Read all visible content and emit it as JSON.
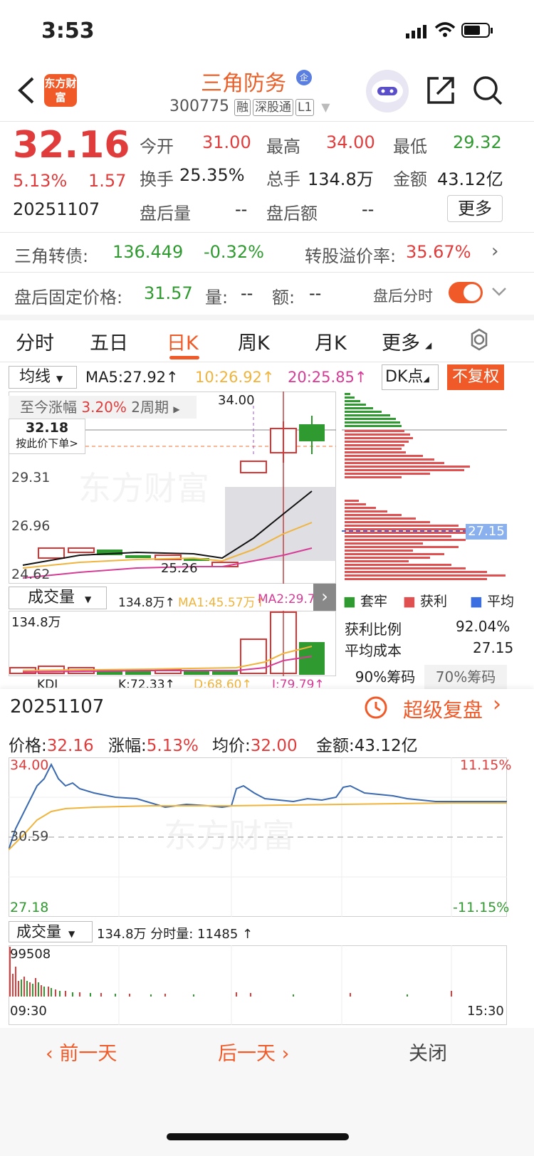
{
  "status": {
    "time": "3:53"
  },
  "header": {
    "name": "三角防务",
    "code": "300775",
    "tags": [
      "融",
      "深股通",
      "L1"
    ],
    "logo": "东方财富",
    "badge": "企"
  },
  "quote": {
    "price": "32.16",
    "pct": "5.13%",
    "chg": "1.57",
    "date": "20251107",
    "open_l": "今开",
    "open": "31.00",
    "high_l": "最高",
    "high": "34.00",
    "low_l": "最低",
    "low": "29.32",
    "turn_l": "换手",
    "turn": "25.35%",
    "vol_l": "总手",
    "vol": "134.8万",
    "amt_l": "金额",
    "amt": "43.12亿",
    "ah_vol_l": "盘后量",
    "ah_vol": "--",
    "ah_amt_l": "盘后额",
    "ah_amt": "--",
    "more": "更多"
  },
  "bond": {
    "label": "三角转债:",
    "price": "136.449",
    "pct": "-0.32%",
    "prem_l": "转股溢价率:",
    "prem": "35.67%"
  },
  "afterhours": {
    "label": "盘后固定价格:",
    "price": "31.57",
    "vol_l": "量:",
    "vol": "--",
    "amt_l": "额:",
    "amt": "--",
    "toggle_l": "盘后分时"
  },
  "tabs": [
    "分时",
    "五日",
    "日K",
    "周K",
    "月K",
    "更多"
  ],
  "kline": {
    "ma_select": "均线",
    "ma5": "MA5:27.92↑",
    "ma10": "10:26.92↑",
    "ma20": "20:25.85↑",
    "dk": "DK点",
    "fq": "不复权",
    "since_l": "至今涨幅",
    "since": "3.20%",
    "period": "2周期",
    "cursor_price": "32.18",
    "cursor_hint": "按此价下单>",
    "y1": "29.31",
    "y2": "26.96",
    "y3": "24.62",
    "hi": "34.00",
    "lo": "25.26",
    "chip_avg": "27.15",
    "vol_select": "成交量",
    "vol_text": "134.8万↑",
    "ma1": "MA1:45.57万↑",
    "ma2": "MA2:29.71...",
    "vol_max": "134.8万",
    "kdj_select": "KDJ",
    "kdj_k": "K:72.33↑",
    "kdj_d": "D:68.60↑",
    "kdj_j": "J:79.79↑",
    "legend": [
      "套牢",
      "获利",
      "平均"
    ],
    "profit_l": "获利比例",
    "profit": "92.04%",
    "cost_l": "平均成本",
    "cost": "27.15",
    "chip_tabs": [
      "90%筹码",
      "70%筹码"
    ],
    "watermark": "东方财富"
  },
  "intraday": {
    "date": "20251107",
    "review": "超级复盘",
    "price_l": "价格:",
    "price": "32.16",
    "pct_l": "涨幅:",
    "pct": "5.13%",
    "avg_l": "均价:",
    "avg": "32.00",
    "amt_l": "金额:",
    "amt": "43.12亿",
    "top": "34.00",
    "mid": "30.59",
    "bot": "27.18",
    "top_pct": "11.15%",
    "bot_pct": "-11.15%",
    "vol_select": "成交量",
    "vol_text": "134.8万 分时量: 11485 ↑",
    "vol_max": "99508",
    "t_start": "09:30",
    "t_end": "15:30"
  },
  "footer": {
    "prev": "前一天",
    "next": "后一天",
    "close": "关闭"
  },
  "colors": {
    "red": "#e03c3c",
    "green": "#2f9a2f",
    "orange": "#f05a28"
  }
}
